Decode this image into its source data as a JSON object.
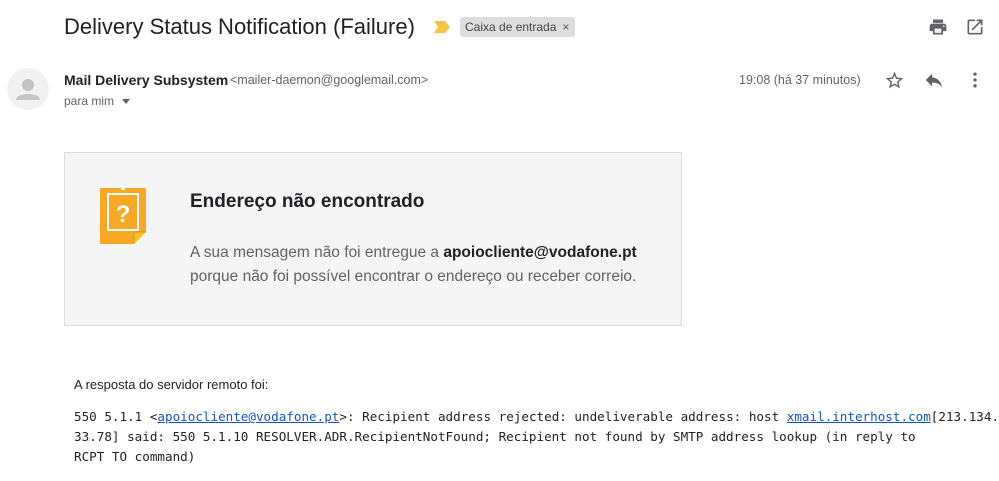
{
  "header": {
    "subject": "Delivery Status Notification (Failure)",
    "label": "Caixa de entrada",
    "label_remove": "×",
    "importance_color": "#f4c542"
  },
  "icons": {
    "print": "print-icon",
    "open_new_window": "open-in-new-window-icon",
    "star": "star-outline-icon",
    "reply": "reply-icon",
    "more": "more-vertical-icon",
    "avatar": "default-person-avatar"
  },
  "sender": {
    "name": "Mail Delivery Subsystem",
    "email": "<mailer-daemon@googlemail.com>",
    "recipient": "para mim",
    "timestamp": "19:08 (há 37 minutos)"
  },
  "card": {
    "title": "Endereço não encontrado",
    "line1_prefix": "A sua mensagem não foi entregue a ",
    "line1_address": "apoiocliente@vodafone.pt",
    "line2": "porque não foi possível encontrar o endereço ou receber correio.",
    "icon_color": "#f9a825",
    "icon_symbol": "?"
  },
  "response": {
    "intro": "A resposta do servidor remoto foi:",
    "line1_a": "550 5.1.1 <",
    "line1_link": "apoiocliente@vodafone.pt",
    "line1_b": ">: Recipient address rejected: undeliverable address: host ",
    "line1_host": "xmail.interhost.com",
    "line1_c": "[213.134.",
    "line2": "33.78] said: 550 5.1.10 RESOLVER.ADR.RecipientNotFound; Recipient not found by SMTP address lookup (in reply to",
    "line3": "RCPT TO command)"
  },
  "colors": {
    "link": "#1155cc",
    "card_bg": "#f5f5f5",
    "chip_bg": "#dddddd"
  }
}
